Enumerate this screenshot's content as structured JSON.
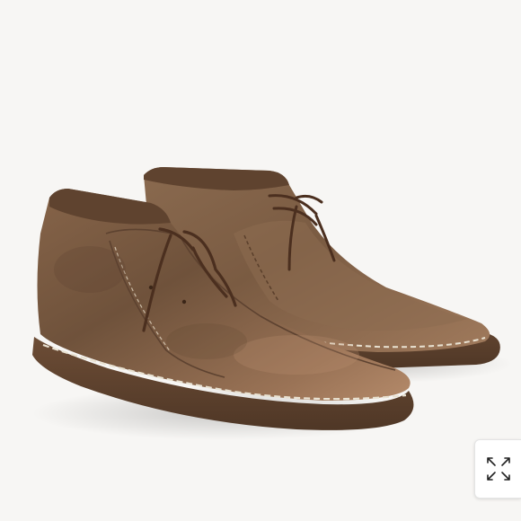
{
  "viewer": {
    "image_subject": "suede-chukka-boots-pair",
    "background_color": "#f7f6f4",
    "leather_color": "#7b5a40",
    "sole_color": "#5a3f2b",
    "stitch_color": "#e9e2d2",
    "lace_color": "#4b2f1f"
  },
  "controls": {
    "expand_icon": "expand-arrows-icon"
  }
}
